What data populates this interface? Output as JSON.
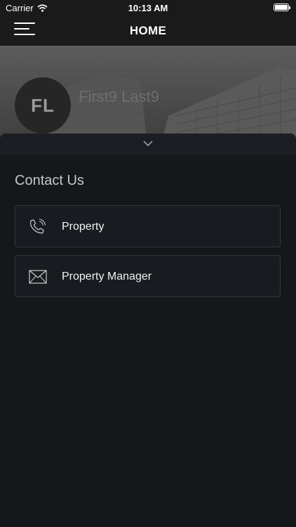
{
  "status_bar": {
    "carrier": "Carrier",
    "time": "10:13 AM"
  },
  "nav": {
    "title": "HOME",
    "menu_icon": "menu-icon"
  },
  "profile": {
    "initials": "FL",
    "name": "First9 Last9"
  },
  "sheet": {
    "handle_icon": "chevron-down-icon",
    "section_title": "Contact Us",
    "items": [
      {
        "label": "Property",
        "icon": "phone-icon"
      },
      {
        "label": "Property Manager",
        "icon": "mail-icon"
      }
    ]
  }
}
